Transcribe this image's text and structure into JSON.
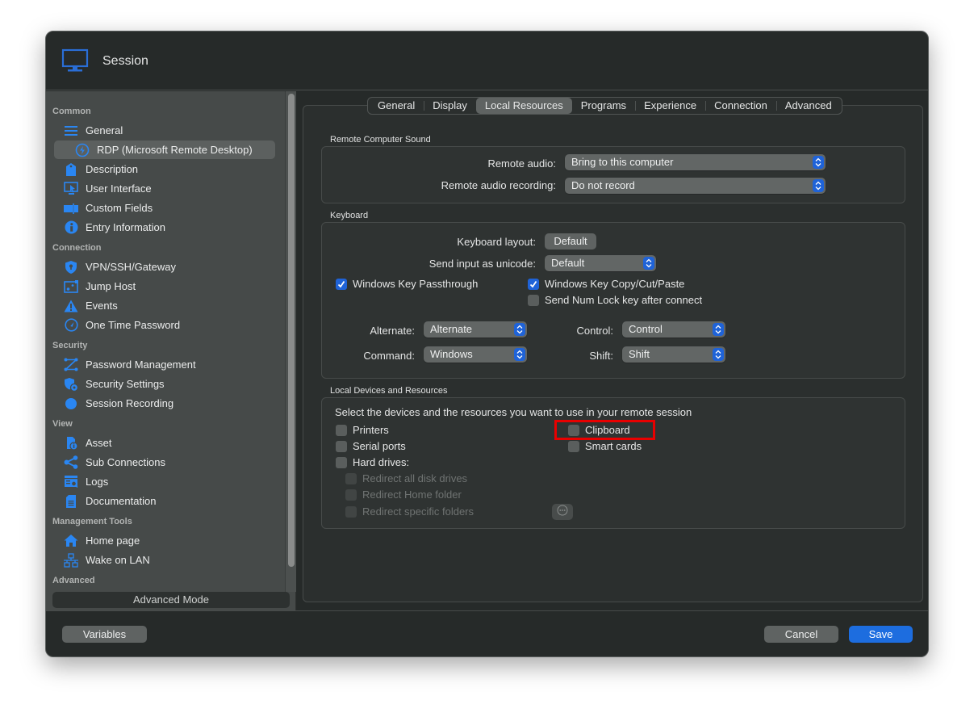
{
  "window": {
    "title": "Session",
    "icon": "monitor-icon"
  },
  "sidebar": {
    "sections": [
      {
        "header": "Common",
        "items": [
          {
            "label": "General",
            "icon": "list-icon"
          },
          {
            "label": "RDP (Microsoft Remote Desktop)",
            "icon": "rdp-icon",
            "active": true,
            "sub": true
          },
          {
            "label": "Description",
            "icon": "tag-icon"
          },
          {
            "label": "User Interface",
            "icon": "screen-cursor-icon"
          },
          {
            "label": "Custom Fields",
            "icon": "fields-icon"
          },
          {
            "label": "Entry Information",
            "icon": "info-icon"
          }
        ]
      },
      {
        "header": "Connection",
        "items": [
          {
            "label": "VPN/SSH/Gateway",
            "icon": "shield-lock-icon"
          },
          {
            "label": "Jump Host",
            "icon": "jump-host-icon"
          },
          {
            "label": "Events",
            "icon": "warning-icon"
          },
          {
            "label": "One Time Password",
            "icon": "gauge-icon"
          }
        ]
      },
      {
        "header": "Security",
        "items": [
          {
            "label": "Password Management",
            "icon": "workflow-icon"
          },
          {
            "label": "Security Settings",
            "icon": "shield-gear-icon"
          },
          {
            "label": "Session Recording",
            "icon": "record-icon"
          }
        ]
      },
      {
        "header": "View",
        "items": [
          {
            "label": "Asset",
            "icon": "asset-icon"
          },
          {
            "label": "Sub Connections",
            "icon": "share-icon"
          },
          {
            "label": "Logs",
            "icon": "logs-icon"
          },
          {
            "label": "Documentation",
            "icon": "document-icon"
          }
        ]
      },
      {
        "header": "Management Tools",
        "items": [
          {
            "label": "Home page",
            "icon": "home-icon"
          },
          {
            "label": "Wake on LAN",
            "icon": "network-icon"
          }
        ]
      },
      {
        "header": "Advanced",
        "items": []
      }
    ],
    "advanced_mode_label": "Advanced Mode"
  },
  "tabs": [
    {
      "label": "General"
    },
    {
      "label": "Display"
    },
    {
      "label": "Local Resources",
      "active": true
    },
    {
      "label": "Programs"
    },
    {
      "label": "Experience"
    },
    {
      "label": "Connection"
    },
    {
      "label": "Advanced"
    }
  ],
  "sound": {
    "title": "Remote Computer Sound",
    "remote_audio_label": "Remote audio:",
    "remote_audio_value": "Bring to this computer",
    "recording_label": "Remote audio recording:",
    "recording_value": "Do not record"
  },
  "keyboard": {
    "title": "Keyboard",
    "layout_label": "Keyboard layout:",
    "layout_value": "Default",
    "unicode_label": "Send input as unicode:",
    "unicode_value": "Default",
    "win_passthrough": {
      "label": "Windows Key Passthrough",
      "checked": true
    },
    "win_copy": {
      "label": "Windows Key Copy/Cut/Paste",
      "checked": true
    },
    "numlock": {
      "label": "Send Num Lock key after connect",
      "checked": false
    },
    "alternate_label": "Alternate:",
    "alternate_value": "Alternate",
    "command_label": "Command:",
    "command_value": "Windows",
    "control_label": "Control:",
    "control_value": "Control",
    "shift_label": "Shift:",
    "shift_value": "Shift"
  },
  "devices": {
    "title": "Local Devices and Resources",
    "description": "Select the devices and the resources you want to use in your remote session",
    "printers": {
      "label": "Printers",
      "checked": false
    },
    "serial_ports": {
      "label": "Serial ports",
      "checked": false
    },
    "hard_drives": {
      "label": "Hard drives:",
      "checked": false
    },
    "clipboard": {
      "label": "Clipboard",
      "checked": false
    },
    "smart_cards": {
      "label": "Smart cards",
      "checked": false
    },
    "redirect_all": {
      "label": "Redirect all disk drives",
      "checked": false,
      "disabled": true
    },
    "redirect_home": {
      "label": "Redirect Home folder",
      "checked": false,
      "disabled": true
    },
    "redirect_specific": {
      "label": "Redirect specific folders",
      "checked": false,
      "disabled": true
    },
    "highlight_color": "#e80000"
  },
  "footer": {
    "variables_label": "Variables",
    "cancel_label": "Cancel",
    "save_label": "Save"
  },
  "colors": {
    "accent": "#1f63d8",
    "save_button": "#1d6ddf",
    "icon_blue": "#2a86f2"
  }
}
